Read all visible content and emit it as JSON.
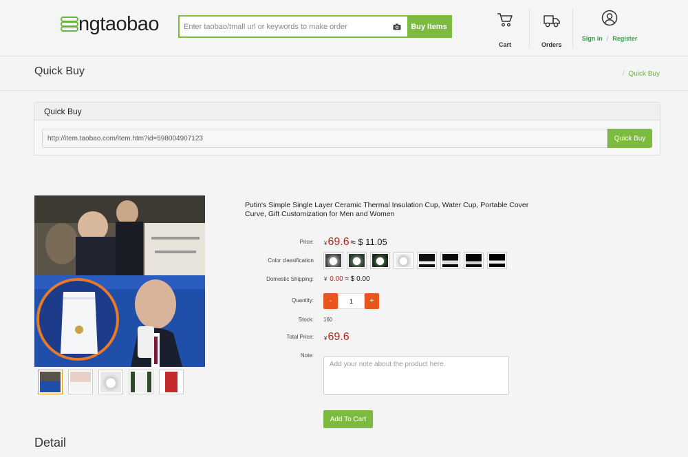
{
  "header": {
    "logo_text": "ngtaobao",
    "search_placeholder": "Enter taobao/tmall url or keywords to make order",
    "buy_items_label": "Buy Items",
    "cart_label": "Cart",
    "orders_label": "Orders",
    "sign_in_label": "Sign in",
    "separator": "/",
    "register_label": "Register"
  },
  "titlebar": {
    "title": "Quick Buy",
    "breadcrumb_sep": "/",
    "breadcrumb": "Quick Buy"
  },
  "quick_buy": {
    "panel_title": "Quick Buy",
    "url_value": "http://item.taobao.com/item.htm?id=598004907123",
    "button_label": "Quick Buy"
  },
  "product": {
    "title": "Putin's Simple Single Layer Ceramic Thermal Insulation Cup, Water Cup, Portable Cover Curve, Gift Customization for Men and Women",
    "labels": {
      "price": "Price:",
      "color": "Color classification",
      "shipping": "Domestic Shipping:",
      "quantity": "Quantity:",
      "stock": "Stock:",
      "total": "Total Price:",
      "note": "Note:"
    },
    "yen_symbol": "¥",
    "price": "69.6",
    "approx_usd": "≈ $ 11.05",
    "shipping_yen": "0.00",
    "shipping_usd": "≈ $ 0.00",
    "qty_minus": "-",
    "qty_plus": "+",
    "quantity": "1",
    "stock": "160",
    "total": "69.6",
    "note_placeholder": "Add your note about the product here.",
    "add_to_cart": "Add To Cart",
    "color_count": 8,
    "thumbnail_count": 5
  },
  "detail_heading": "Detail",
  "colors": {
    "accent_green": "#7cbb3f",
    "price_red": "#c0201a",
    "qty_orange": "#e8561d"
  }
}
